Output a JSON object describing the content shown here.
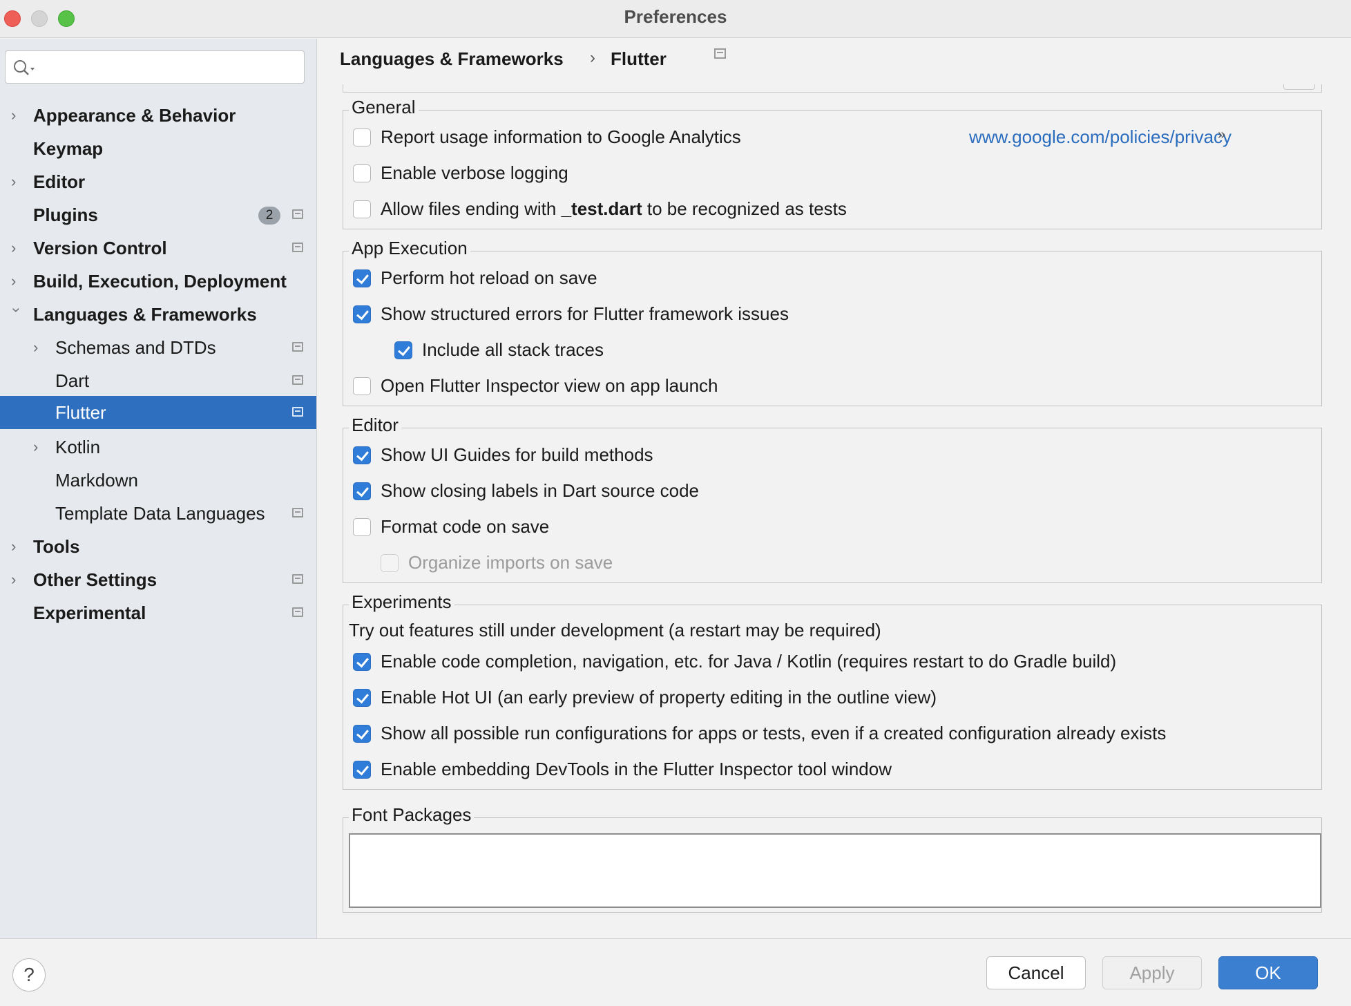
{
  "window": {
    "title": "Preferences"
  },
  "sidebar": {
    "search_placeholder": "",
    "items": [
      {
        "label": "Appearance & Behavior",
        "bold": true
      },
      {
        "label": "Keymap",
        "bold": true
      },
      {
        "label": "Editor",
        "bold": true
      },
      {
        "label": "Plugins",
        "bold": true,
        "badge": "2"
      },
      {
        "label": "Version Control",
        "bold": true
      },
      {
        "label": "Build, Execution, Deployment",
        "bold": true
      },
      {
        "label": "Languages & Frameworks",
        "bold": true
      },
      {
        "label": "Schemas and DTDs"
      },
      {
        "label": "Dart"
      },
      {
        "label": "Flutter",
        "selected": true
      },
      {
        "label": "Kotlin"
      },
      {
        "label": "Markdown"
      },
      {
        "label": "Template Data Languages"
      },
      {
        "label": "Tools",
        "bold": true
      },
      {
        "label": "Other Settings",
        "bold": true
      },
      {
        "label": "Experimental",
        "bold": true
      }
    ]
  },
  "breadcrumb": {
    "parent": "Languages & Frameworks",
    "separator": "›",
    "current": "Flutter"
  },
  "general": {
    "title": "General",
    "report_usage": {
      "label": "Report usage information to Google Analytics",
      "checked": false
    },
    "privacy_link": "www.google.com/policies/privacy",
    "link_arrow": "»",
    "verbose_logging": {
      "label": "Enable verbose logging",
      "checked": false
    },
    "test_files": {
      "prefix": "Allow files ending with ",
      "highlight": "_test.dart",
      "suffix": " to be recognized as tests",
      "checked": false
    }
  },
  "app_execution": {
    "title": "App Execution",
    "hot_reload": {
      "label": "Perform hot reload on save",
      "checked": true
    },
    "structured_errors": {
      "label": "Show structured errors for Flutter framework issues",
      "checked": true
    },
    "stack_traces": {
      "label": "Include all stack traces",
      "checked": true
    },
    "open_inspector": {
      "label": "Open Flutter Inspector view on app launch",
      "checked": false
    }
  },
  "editor": {
    "title": "Editor",
    "ui_guides": {
      "label": "Show UI Guides for build methods",
      "checked": true
    },
    "closing_labels": {
      "label": "Show closing labels in Dart source code",
      "checked": true
    },
    "format_on_save": {
      "label": "Format code on save",
      "checked": false
    },
    "organize_imports": {
      "label": "Organize imports on save",
      "checked": false,
      "disabled": true
    }
  },
  "experiments": {
    "title": "Experiments",
    "description": "Try out features still under development (a restart may be required)",
    "code_completion": {
      "label": "Enable code completion, navigation, etc. for Java / Kotlin (requires restart to do Gradle build)",
      "checked": true
    },
    "hot_ui": {
      "label": "Enable Hot UI (an early preview of property editing in the outline view)",
      "checked": true
    },
    "run_configs": {
      "label": "Show all possible run configurations for apps or tests, even if a created configuration already exists",
      "checked": true
    },
    "devtools": {
      "label": "Enable embedding DevTools in the Flutter Inspector tool window",
      "checked": true
    }
  },
  "font_packages": {
    "title": "Font Packages",
    "value": ""
  },
  "footer": {
    "help": "?",
    "cancel": "Cancel",
    "apply": "Apply",
    "ok": "OK"
  },
  "colors": {
    "accent": "#2e6fc0",
    "link": "#2a6cbe",
    "ok_button": "#3b7fd1"
  }
}
